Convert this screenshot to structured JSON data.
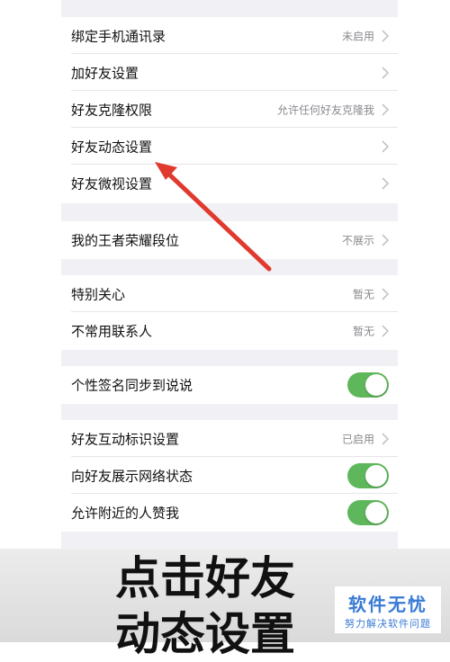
{
  "groups": [
    {
      "rows": [
        {
          "label": "绑定手机通讯录",
          "value": "未启用",
          "control": "chevron"
        },
        {
          "label": "加好友设置",
          "value": "",
          "control": "chevron"
        },
        {
          "label": "好友克隆权限",
          "value": "允许任何好友克隆我",
          "control": "chevron"
        },
        {
          "label": "好友动态设置",
          "value": "",
          "control": "chevron"
        },
        {
          "label": "好友微视设置",
          "value": "",
          "control": "chevron"
        }
      ]
    },
    {
      "rows": [
        {
          "label": "我的王者荣耀段位",
          "value": "不展示",
          "control": "chevron"
        }
      ]
    },
    {
      "rows": [
        {
          "label": "特别关心",
          "value": "暂无",
          "control": "chevron"
        },
        {
          "label": "不常用联系人",
          "value": "暂无",
          "control": "chevron"
        }
      ]
    },
    {
      "rows": [
        {
          "label": "个性签名同步到说说",
          "value": "",
          "control": "toggle",
          "on": true
        }
      ]
    },
    {
      "rows": [
        {
          "label": "好友互动标识设置",
          "value": "已启用",
          "control": "chevron"
        },
        {
          "label": "向好友展示网络状态",
          "value": "",
          "control": "toggle",
          "on": true
        },
        {
          "label": "允许附近的人赞我",
          "value": "",
          "control": "toggle",
          "on": true
        }
      ]
    }
  ],
  "caption": "点击好友\n动态设置",
  "watermark": {
    "title": "软件无忧",
    "subtitle": "努力解决软件问题"
  },
  "colors": {
    "toggle_on": "#5fb75b",
    "annotation_arrow": "#e03a2f",
    "watermark": "#3a7bd5"
  }
}
